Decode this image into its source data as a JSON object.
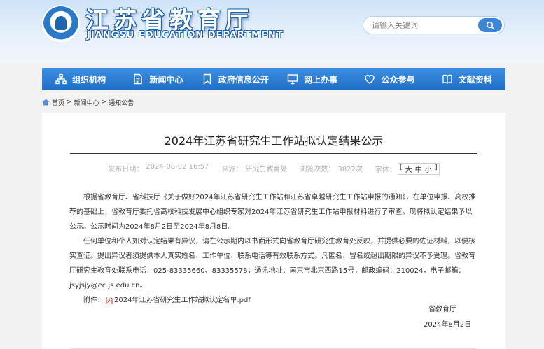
{
  "header": {
    "title_cn": "江苏省教育厅",
    "title_en": "JIANGSU EDUCATION DEPARTMENT",
    "search": {
      "placeholder": "请输入关键词"
    }
  },
  "nav": {
    "items": [
      {
        "label": "组织机构",
        "icon": "org-chart-icon"
      },
      {
        "label": "新闻中心",
        "icon": "document-icon"
      },
      {
        "label": "政府信息公开",
        "icon": "bookmark-icon"
      },
      {
        "label": "网上办事",
        "icon": "monitor-icon"
      },
      {
        "label": "公众参与",
        "icon": "heart-icon"
      },
      {
        "label": "文献资料",
        "icon": "book-icon"
      }
    ]
  },
  "breadcrumb": {
    "home": "首页",
    "sep": ">",
    "news": "新闻中心",
    "notice": "通知公告"
  },
  "article": {
    "title": "2024年江苏省研究生工作站拟认定结果公示",
    "meta": {
      "date_label": "发布日期：",
      "date": "2024-08-02 16:57",
      "source_label": "来源：",
      "source": "研究生教育处",
      "views_label": "浏览次数：",
      "views": "3822次",
      "fontsize_label": "字体：",
      "fontsize_bracket_open": "[",
      "fontsize_large": "大",
      "fontsize_medium": "中",
      "fontsize_small": "小",
      "fontsize_bracket_close": "]"
    },
    "paragraph1": "根据省教育厅、省科技厅《关于做好2024年江苏省研究生工作站和江苏省卓越研究生工作站申报的通知》，在单位申报、高校推荐的基础上，省教育厅委托省高校科技发展中心组织专家对2024年江苏省研究生工作站申报材料进行了审查。现将拟认定结果予以公示。公示时间为2024年8月2日至2024年8月8日。",
    "paragraph2": "任何单位和个人如对认定结果有异议，请在公示期内以书面形式向省教育厅研究生教育处反映，并提供必要的佐证材料，以便核实查证。提出异议者须提供本人真实姓名、工作单位、联系电话等有效联系方式。凡匿名、冒名或超出期限的异议不予受理。省教育厅研究生教育处联系电话：025-83335660、83335578；通讯地址：南京市北京西路15号，邮政编码：210024，电子邮箱：jsyjsjy@ec.js.edu.cn。",
    "attachment_label": "附件：",
    "attachment_name": "2024年江苏省研究生工作站拟认定名单.pdf",
    "signature": "省教育厅",
    "sign_date": "2024年8月2日"
  },
  "colors": {
    "nav_blue": "#1f6fc8",
    "brand_blue": "#1a5fa8",
    "text": "#333333",
    "meta_gray": "#b0b0b0",
    "pdf_red": "#d8322b"
  }
}
